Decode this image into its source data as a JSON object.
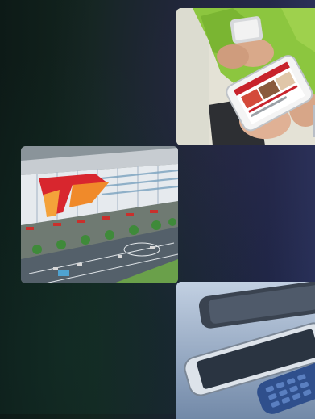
{
  "background": {
    "colors": [
      "#0d1a17",
      "#1a2333",
      "#283058"
    ]
  },
  "photos": [
    {
      "name": "photo-phones-hands",
      "icon": "smartphones-in-hands-image"
    },
    {
      "name": "photo-mall",
      "icon": "shopping-mall-aerial-image"
    },
    {
      "name": "photo-devices",
      "icon": "mobile-devices-on-table-image"
    }
  ]
}
